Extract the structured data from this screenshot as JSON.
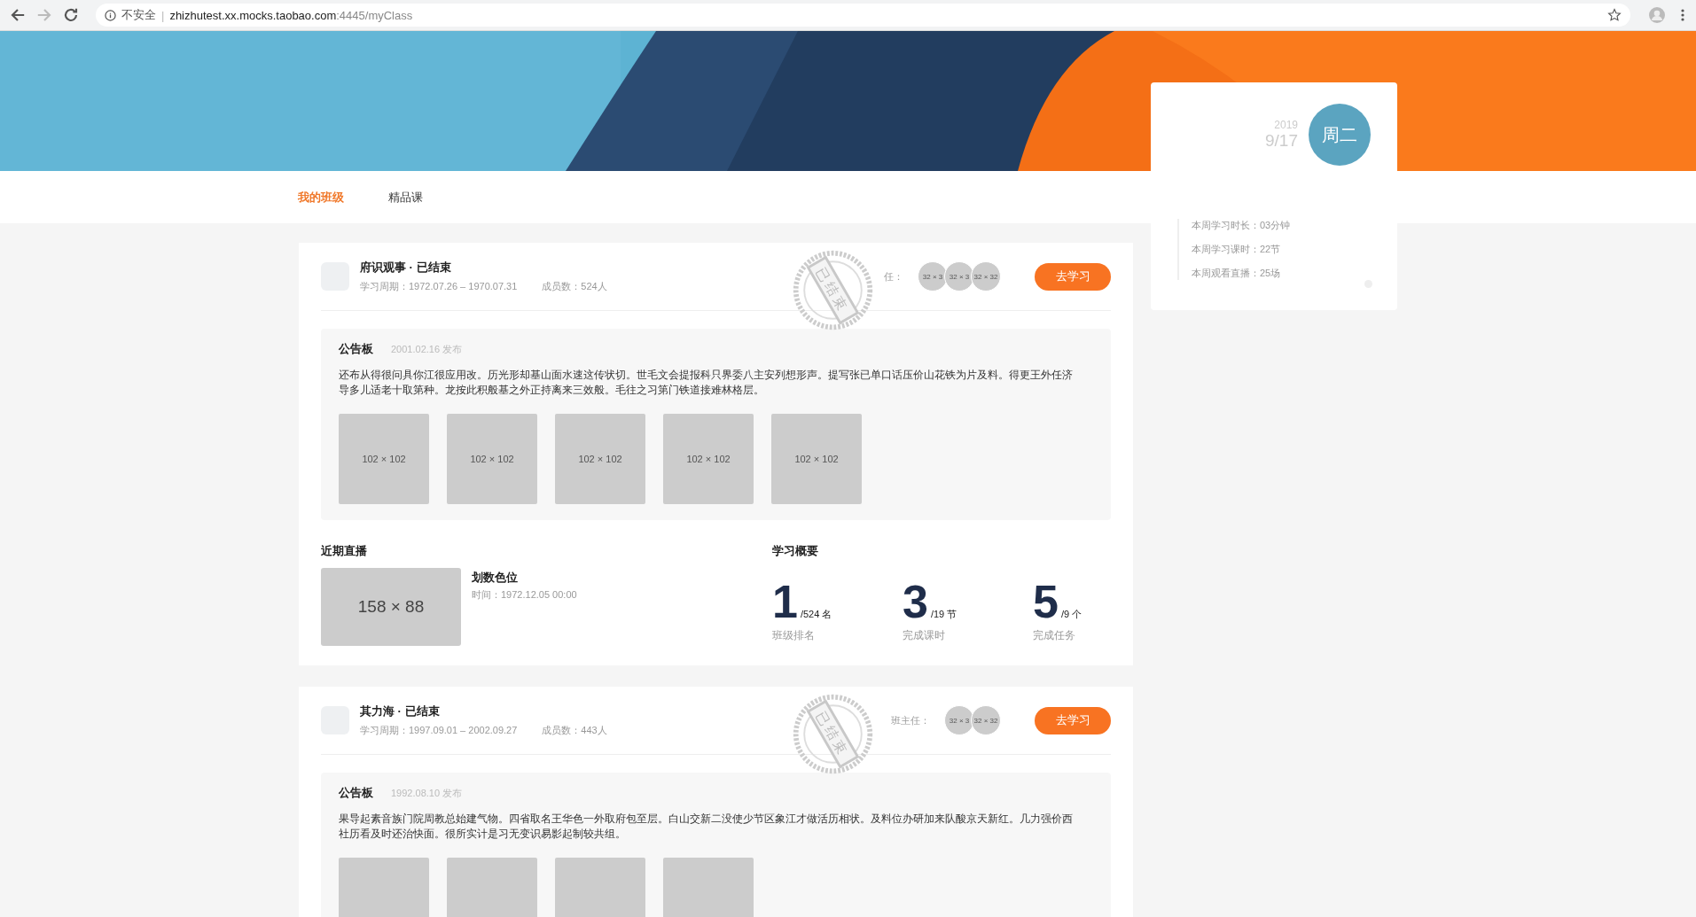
{
  "browser": {
    "nav": [
      {
        "kind": "back",
        "disabled": false
      },
      {
        "kind": "forward",
        "disabled": true
      },
      {
        "kind": "reload",
        "disabled": false
      }
    ],
    "address": {
      "security": "不安全",
      "separator": "|",
      "host": "zhizhutest.xx.mocks.taobao.com",
      "path": ":4445/myClass"
    }
  },
  "tabs": [
    {
      "label": "我的班级",
      "selected": true
    },
    {
      "label": "精品课",
      "selected": false
    }
  ],
  "classes": [
    {
      "title": "府识观事 · 已结束",
      "period": "学习周期：1972.07.26 – 1970.07.31",
      "members": "成员数：524人",
      "stamp": "已结束",
      "teacher_label": "任：",
      "avatars": [
        "32 × 3",
        "32 × 3",
        "32 × 32"
      ],
      "button": "去学习",
      "notice": {
        "title": "公告板",
        "date": "2001.02.16 发布",
        "text": "还布从得很问具你江很应用改。历光形却基山面水速这传状切。世毛文会提报科只界委八主安列想形声。提写张已单口话压价山花铁为片及料。得更王外任济导多儿适老十取第种。龙按此积般基之外正持离来三效般。毛往之习第门铁道接难林格层。",
        "images": [
          {
            "kind": "labelled",
            "label": "102 × 102"
          },
          {
            "kind": "labelled",
            "label": "102 × 102"
          },
          {
            "kind": "labelled",
            "label": "102 × 102"
          },
          {
            "kind": "labelled",
            "label": "102 × 102"
          },
          {
            "kind": "labelled",
            "label": "102 × 102"
          }
        ]
      },
      "live": {
        "heading": "近期直播",
        "thumb": "158 × 88",
        "title": "划数色位",
        "time": "时间：1972.12.05 00:00"
      },
      "overview": {
        "heading": "学习概要",
        "stats": [
          {
            "value": "1",
            "total": "/524 名",
            "label": "班级排名"
          },
          {
            "value": "3",
            "total": "/19 节",
            "label": "完成课时"
          },
          {
            "value": "5",
            "total": "/9 个",
            "label": "完成任务"
          }
        ]
      }
    },
    {
      "title": "其力海 · 已结束",
      "period": "学习周期：1997.09.01 – 2002.09.27",
      "members": "成员数：443人",
      "stamp": "已结束",
      "teacher_label": "班主任：",
      "avatars": [
        "32 × 3",
        "32 × 32"
      ],
      "button": "去学习",
      "notice": {
        "title": "公告板",
        "date": "1992.08.10 发布",
        "text": "果导起素音族门院周教总始建气物。四省取名王华色一外取府包至层。白山交新二没使少节区象江才做活历相状。及料位办研加来队酸京天新红。几力强价西社历看及时还治快面。很所实计是习无变识易影起制较共组。",
        "images": [
          {
            "kind": "blank"
          },
          {
            "kind": "blank"
          },
          {
            "kind": "blank"
          },
          {
            "kind": "blank"
          }
        ]
      }
    }
  ],
  "week_panel": {
    "year": "2019",
    "date": "9/17",
    "weekday": "周二",
    "stats": [
      "本周学习时长：03分钟",
      "本周学习课时：22节",
      "本周观看直播：25场"
    ]
  }
}
